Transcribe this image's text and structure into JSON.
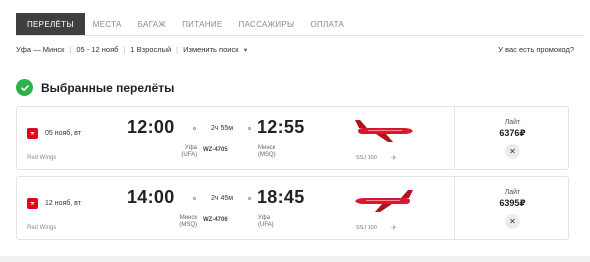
{
  "tabs": [
    {
      "label": "ПЕРЕЛЁТЫ",
      "active": true
    },
    {
      "label": "МЕСТА",
      "active": false
    },
    {
      "label": "БАГАЖ",
      "active": false
    },
    {
      "label": "ПИТАНИЕ",
      "active": false
    },
    {
      "label": "ПАССАЖИРЫ",
      "active": false
    },
    {
      "label": "ОПЛАТА",
      "active": false
    }
  ],
  "search": {
    "route": "Уфа — Минск",
    "dates": "05 - 12 нояб",
    "passengers": "1 Взрослый",
    "change_label": "Изменить поиск",
    "promo_label": "У вас есть промокод?"
  },
  "section_title": "Выбранные перелёты",
  "colors": {
    "brand": "#e3001b",
    "success": "#2db24a",
    "tab_active_bg": "#3f3f3f"
  },
  "flights": [
    {
      "date": "05 нояб, вт",
      "airline": "Red Wings",
      "dep_time": "12:00",
      "dep_city": "Уфа",
      "dep_code": "(UFA)",
      "duration": "2ч 55м",
      "flight_no": "WZ-4705",
      "arr_time": "12:55",
      "arr_city": "Минск",
      "arr_code": "(MSQ)",
      "aircraft": "SSJ 100",
      "fare_name": "Лайт",
      "price": "6376₽"
    },
    {
      "date": "12 нояб, вт",
      "airline": "Red Wings",
      "dep_time": "14:00",
      "dep_city": "Минск",
      "dep_code": "(MSQ)",
      "duration": "2ч 45м",
      "flight_no": "WZ-4706",
      "arr_time": "18:45",
      "arr_city": "Уфа",
      "arr_code": "(UFA)",
      "aircraft": "SSJ 100",
      "fare_name": "Лайт",
      "price": "6395₽"
    }
  ],
  "icons": {
    "check": "check-circle-icon",
    "close": "close-icon",
    "seat": "seat-icon",
    "airline": "red-wings-logo-icon",
    "chevron": "chevron-down-icon"
  }
}
